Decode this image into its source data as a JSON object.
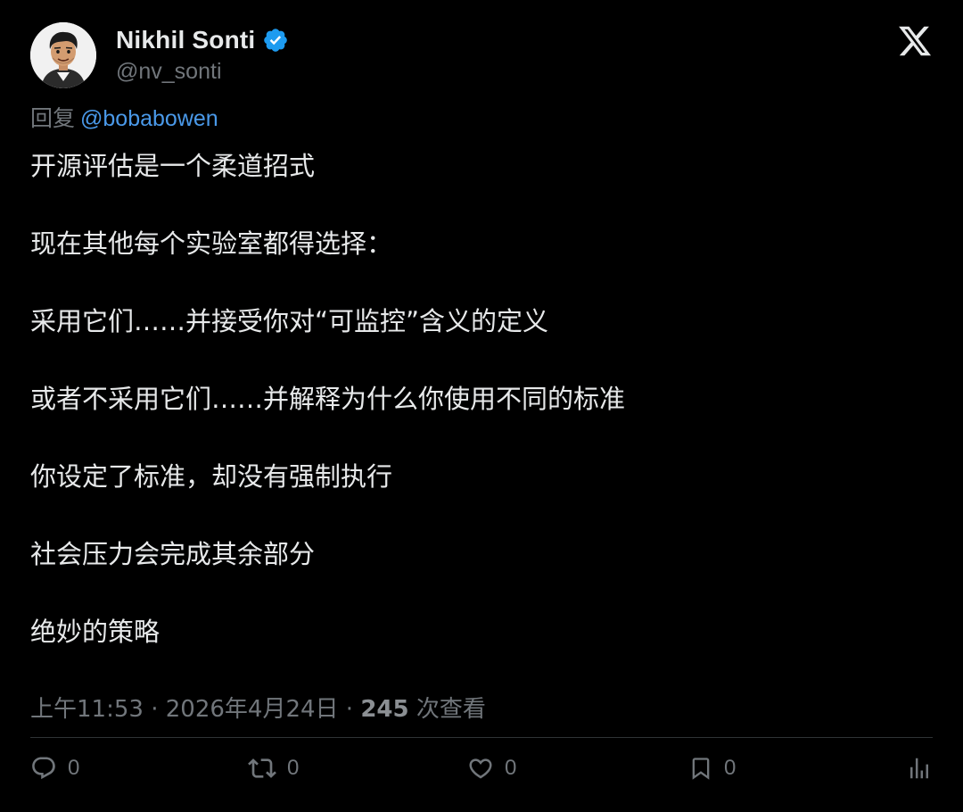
{
  "author": {
    "display_name": "Nikhil Sonti",
    "handle": "@nv_sonti",
    "verified": true,
    "avatar": "cartoon-portrait"
  },
  "platform_logo": "x-logo-icon",
  "reply_to": {
    "prefix": "回复",
    "mention": "@bobabowen"
  },
  "tweet_lines": [
    "开源评估是一个柔道招式",
    "现在其他每个实验室都得选择：",
    "采用它们……并接受你对“可监控”含义的定义",
    "或者不采用它们……并解释为什么你使用不同的标准",
    "你设定了标准，却没有强制执行",
    "社会压力会完成其余部分",
    "绝妙的策略"
  ],
  "meta": {
    "time": "上午11:53",
    "separator": "·",
    "date": "2026年4月24日",
    "views_count": "245",
    "views_label": "次查看"
  },
  "actions": {
    "reply_count": "0",
    "retweet_count": "0",
    "like_count": "0",
    "bookmark_count": "0"
  },
  "colors": {
    "background": "#000000",
    "text": "#e7e9ea",
    "secondary": "#71767b",
    "link": "#4a99e9",
    "verified_badge": "#1d9bf0"
  }
}
